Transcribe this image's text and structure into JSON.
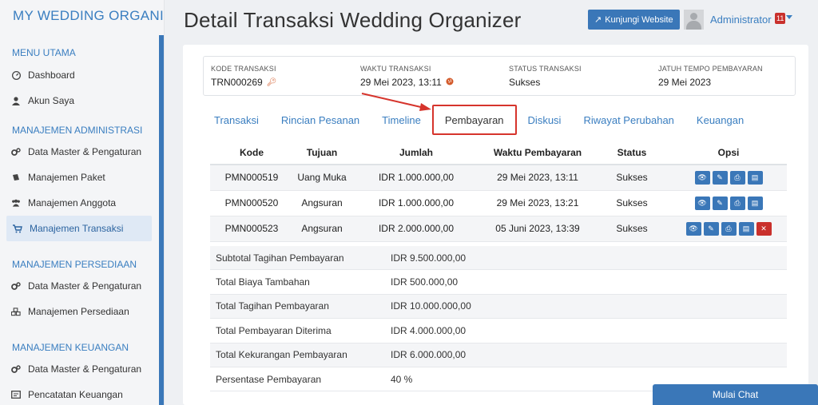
{
  "brand": {
    "title": "MY WEDDING ORGANIZER"
  },
  "sidebar": {
    "sections": [
      {
        "title": "MENU UTAMA"
      },
      {
        "title": "MANAJEMEN ADMINISTRASI"
      },
      {
        "title": "MANAJEMEN PERSEDIAAN"
      },
      {
        "title": "MANAJEMEN KEUANGAN"
      }
    ],
    "items": [
      {
        "label": "Dashboard",
        "icon": "dashboard-icon"
      },
      {
        "label": "Akun Saya",
        "icon": "user-icon"
      },
      {
        "label": "Data Master & Pengaturan",
        "icon": "cogs-icon"
      },
      {
        "label": "Manajemen Paket",
        "icon": "book-icon"
      },
      {
        "label": "Manajemen Anggota",
        "icon": "users-icon"
      },
      {
        "label": "Manajemen Transaksi",
        "icon": "cart-icon",
        "active": true
      },
      {
        "label": "Data Master & Pengaturan",
        "icon": "cogs-icon"
      },
      {
        "label": "Manajemen Persediaan",
        "icon": "cubes-icon"
      },
      {
        "label": "Data Master & Pengaturan",
        "icon": "cogs-icon"
      },
      {
        "label": "Pencatatan Keuangan",
        "icon": "ledger-icon"
      }
    ]
  },
  "header": {
    "title": "Detail Transaksi Wedding Organizer",
    "visit_label": "Kunjungi Website",
    "user_name": "Administrator",
    "notification_count": "11"
  },
  "summary": {
    "kode_label": "KODE TRANSAKSI",
    "kode_value": "TRN000269",
    "waktu_label": "WAKTU TRANSAKSI",
    "waktu_value": "29 Mei 2023, 13:11",
    "status_label": "STATUS TRANSAKSI",
    "status_value": "Sukses",
    "jatuh_label": "JATUH TEMPO PEMBAYARAN",
    "jatuh_value": "29 Mei 2023"
  },
  "tabs": [
    {
      "label": "Transaksi"
    },
    {
      "label": "Rincian Pesanan"
    },
    {
      "label": "Timeline"
    },
    {
      "label": "Pembayaran",
      "active": true
    },
    {
      "label": "Diskusi"
    },
    {
      "label": "Riwayat Perubahan"
    },
    {
      "label": "Keuangan"
    }
  ],
  "payments": {
    "headers": {
      "kode": "Kode",
      "tujuan": "Tujuan",
      "jumlah": "Jumlah",
      "waktu": "Waktu Pembayaran",
      "status": "Status",
      "opsi": "Opsi"
    },
    "rows": [
      {
        "kode": "PMN000519",
        "tujuan": "Uang Muka",
        "jumlah": "IDR 1.000.000,00",
        "waktu": "29 Mei 2023, 13:11",
        "status": "Sukses"
      },
      {
        "kode": "PMN000520",
        "tujuan": "Angsuran",
        "jumlah": "IDR 1.000.000,00",
        "waktu": "29 Mei 2023, 13:21",
        "status": "Sukses"
      },
      {
        "kode": "PMN000523",
        "tujuan": "Angsuran",
        "jumlah": "IDR 2.000.000,00",
        "waktu": "05 Juni 2023, 13:39",
        "status": "Sukses"
      }
    ]
  },
  "totals": [
    {
      "label": "Subtotal Tagihan Pembayaran",
      "value": "IDR 9.500.000,00"
    },
    {
      "label": "Total Biaya Tambahan",
      "value": "IDR 500.000,00"
    },
    {
      "label": "Total Tagihan Pembayaran",
      "value": "IDR 10.000.000,00"
    },
    {
      "label": "Total Pembayaran Diterima",
      "value": "IDR 4.000.000,00"
    },
    {
      "label": "Total Kekurangan Pembayaran",
      "value": "IDR 6.000.000,00"
    },
    {
      "label": "Persentase Pembayaran",
      "value": "40 %"
    }
  ],
  "chat": {
    "label": "Mulai Chat"
  },
  "colors": {
    "accent": "#3a77b8",
    "danger": "#c9302c",
    "highlight": "#d6342c"
  }
}
